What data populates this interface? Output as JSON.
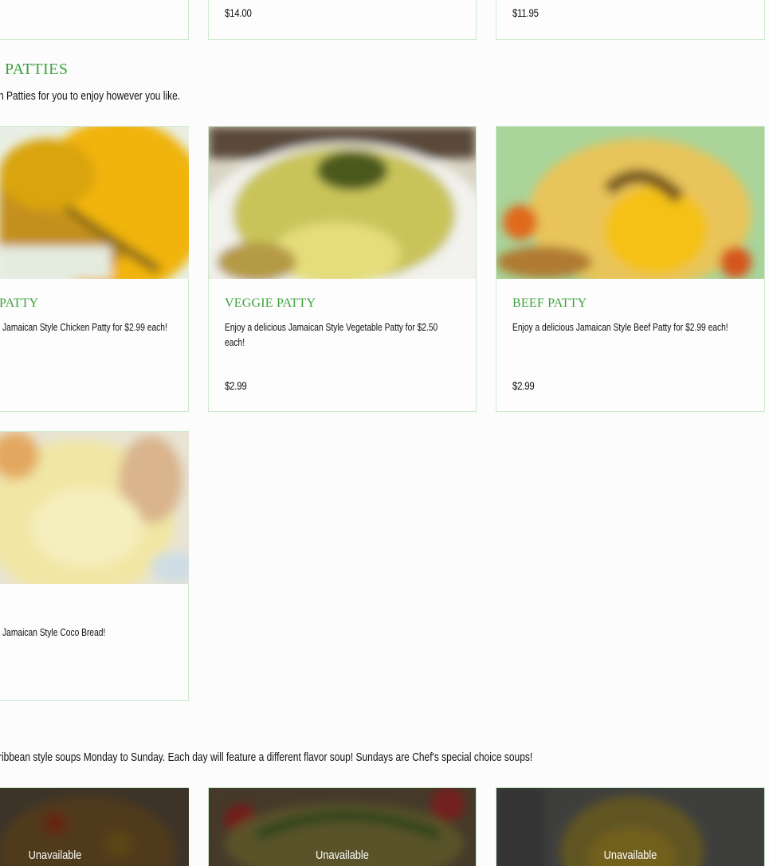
{
  "top_row": {
    "card2_price": "$14.00",
    "card3_price": "$11.95"
  },
  "patties_section": {
    "title": "PATTIES",
    "description": "n Patties for you to enjoy however you like.",
    "items": [
      {
        "title": "PATTY",
        "description": "Jamaican Style Chicken Patty for $2.99 each!",
        "price": ""
      },
      {
        "title": "VEGGIE PATTY",
        "description": "Enjoy a delicious Jamaican Style Vegetable Patty for $2.50 each!",
        "price": "$2.99"
      },
      {
        "title": "BEEF PATTY",
        "description": "Enjoy a delicious Jamaican Style Beef Patty for $2.99 each!",
        "price": "$2.99"
      },
      {
        "title": "",
        "description": "Jamaican Style Coco Bread!",
        "price": ""
      }
    ]
  },
  "soups_section": {
    "description": "ribbean style soups Monday to Sunday. Each day will feature a different flavor soup! Sundays are Chef's special choice soups!",
    "items": [
      {
        "status": "Unavailable"
      },
      {
        "status": "Unavailable"
      },
      {
        "status": "Unavailable"
      }
    ]
  },
  "colors": {
    "accent_green": "#3ba23b",
    "card_border": "#cfe8cf",
    "background": "#fcfcfc"
  }
}
